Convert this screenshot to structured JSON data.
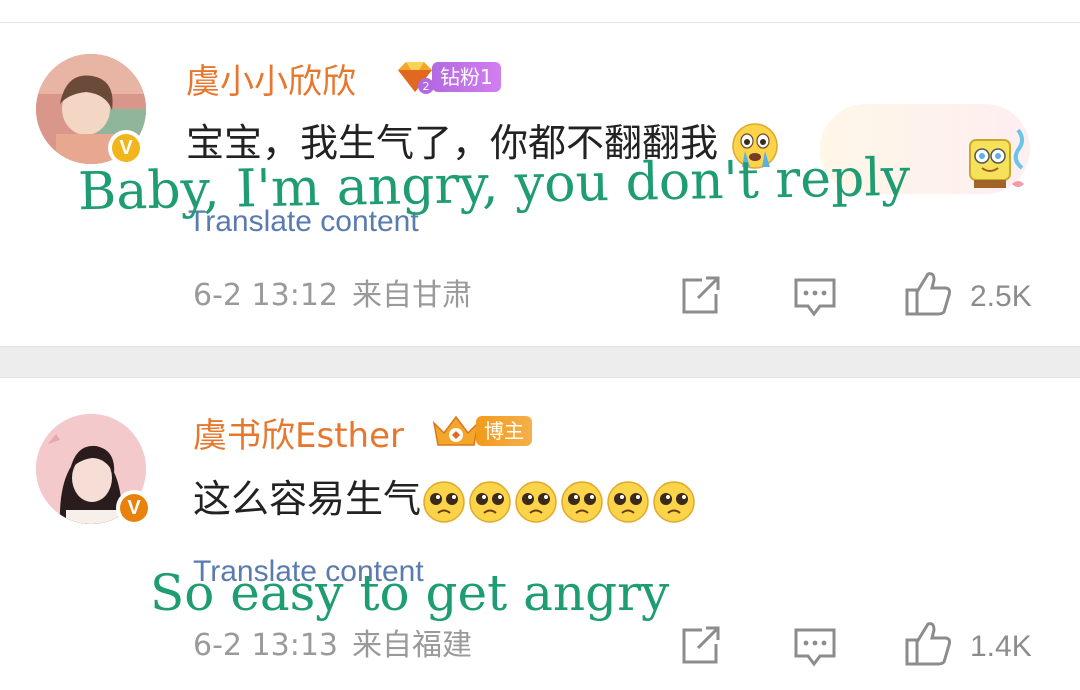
{
  "comments": [
    {
      "username": "虞小小欣欣",
      "badge_label": "钻粉1",
      "text": "宝宝，我生气了，你都不翻翻我",
      "overlay_translation": "Baby, I'm angry, you don't reply",
      "translate_label": "Translate content",
      "date": "6-2 13:12",
      "location": "来自甘肃",
      "likes": "2.5K",
      "verified_color": "#f2b51c"
    },
    {
      "username": "虞书欣Esther",
      "badge_label": "博主",
      "text": "这么容易生气",
      "overlay_translation": "So easy to get angry",
      "translate_label": "Translate content",
      "date": "6-2 13:13",
      "location": "来自福建",
      "likes": "1.4K",
      "verified_color": "#e8820c"
    }
  ],
  "colors": {
    "username": "#e8772e",
    "overlay": "#1e9c72",
    "translate_link": "#5a7bb0",
    "diamond_badge": "#b36ae0",
    "blogger_badge": "#f29a1c"
  },
  "icons": [
    "verified-v-icon",
    "diamond-fan-icon",
    "crown-icon",
    "crying-emoji-icon",
    "pleading-emoji-icon",
    "share-icon",
    "comment-icon",
    "like-icon",
    "spongebob-sticker-icon"
  ]
}
